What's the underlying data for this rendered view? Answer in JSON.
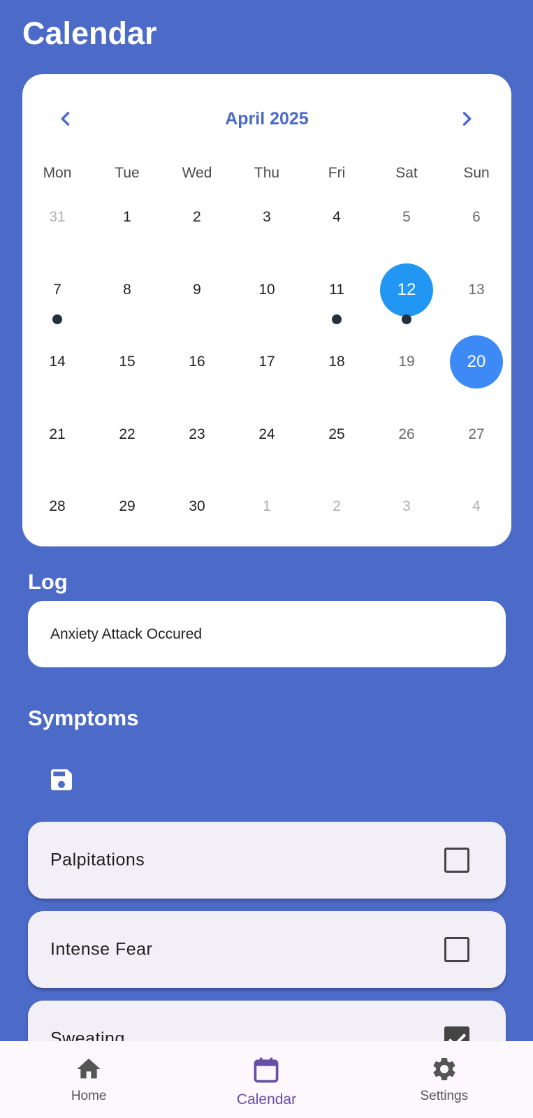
{
  "app": {
    "title": "Calendar"
  },
  "calendar": {
    "month_label": "April 2025",
    "prev_icon": "chevron-left-icon",
    "next_icon": "chevron-right-icon",
    "days_of_week": [
      "Mon",
      "Tue",
      "Wed",
      "Thu",
      "Fri",
      "Sat",
      "Sun"
    ],
    "weeks": [
      [
        {
          "d": "31",
          "outside": true,
          "weekend": false
        },
        {
          "d": "1"
        },
        {
          "d": "2"
        },
        {
          "d": "3"
        },
        {
          "d": "4"
        },
        {
          "d": "5",
          "weekend": true
        },
        {
          "d": "6",
          "weekend": true
        }
      ],
      [
        {
          "d": "7",
          "marker": true
        },
        {
          "d": "8"
        },
        {
          "d": "9"
        },
        {
          "d": "10"
        },
        {
          "d": "11",
          "marker": true
        },
        {
          "d": "12",
          "weekend": true,
          "today": true,
          "marker": true
        },
        {
          "d": "13",
          "weekend": true
        }
      ],
      [
        {
          "d": "14"
        },
        {
          "d": "15"
        },
        {
          "d": "16"
        },
        {
          "d": "17"
        },
        {
          "d": "18"
        },
        {
          "d": "19",
          "weekend": true
        },
        {
          "d": "20",
          "weekend": true,
          "selected": true
        }
      ],
      [
        {
          "d": "21"
        },
        {
          "d": "22"
        },
        {
          "d": "23"
        },
        {
          "d": "24"
        },
        {
          "d": "25"
        },
        {
          "d": "26",
          "weekend": true
        },
        {
          "d": "27",
          "weekend": true
        }
      ],
      [
        {
          "d": "28"
        },
        {
          "d": "29"
        },
        {
          "d": "30"
        },
        {
          "d": "1",
          "outside": true
        },
        {
          "d": "2",
          "outside": true
        },
        {
          "d": "3",
          "outside": true
        },
        {
          "d": "4",
          "outside": true
        }
      ]
    ]
  },
  "log": {
    "title": "Log",
    "entry": "Anxiety Attack Occured"
  },
  "symptoms": {
    "title": "Symptoms",
    "save_icon": "save-icon",
    "items": [
      {
        "label": "Palpitations",
        "checked": false
      },
      {
        "label": "Intense Fear",
        "checked": false
      },
      {
        "label": "Sweating",
        "checked": true
      }
    ]
  },
  "bottom_nav": {
    "items": [
      {
        "label": "Home",
        "icon": "home-icon",
        "active": false
      },
      {
        "label": "Calendar",
        "icon": "calendar-icon",
        "active": true
      },
      {
        "label": "Settings",
        "icon": "gear-icon",
        "active": false
      }
    ]
  },
  "colors": {
    "background": "#4c6bc8",
    "accent": "#4c6bc8",
    "today": "#2196f3",
    "selected": "#3d8af7",
    "nav_active": "#6650a4"
  }
}
